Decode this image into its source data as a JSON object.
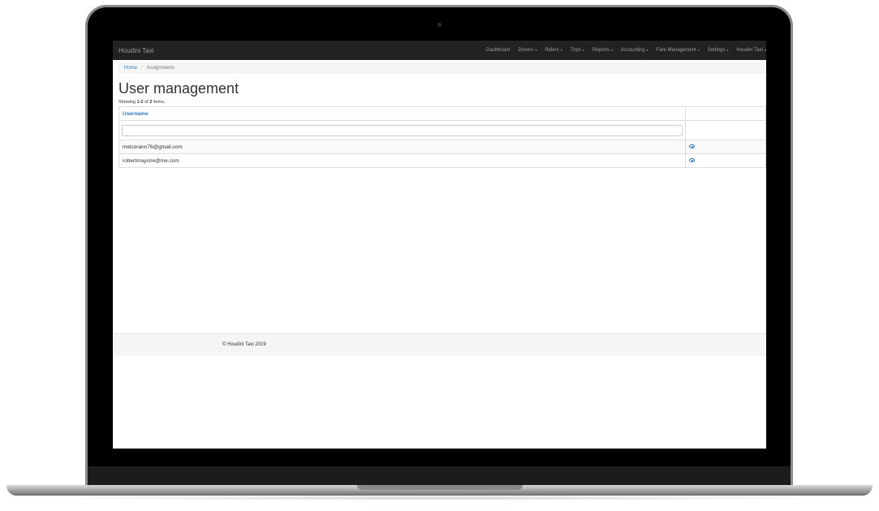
{
  "app": {
    "brand": "Houdini Taxi"
  },
  "nav": {
    "items": [
      {
        "label": "Dashboard",
        "dropdown": false
      },
      {
        "label": "Drivers",
        "dropdown": true
      },
      {
        "label": "Riders",
        "dropdown": true
      },
      {
        "label": "Trips",
        "dropdown": true
      },
      {
        "label": "Reports",
        "dropdown": true
      },
      {
        "label": "Accounting",
        "dropdown": true
      },
      {
        "label": "Fare Management",
        "dropdown": true
      },
      {
        "label": "Settings",
        "dropdown": true
      },
      {
        "label": "Houdini Taxi",
        "dropdown": true
      }
    ],
    "caret": "▾"
  },
  "breadcrumb": {
    "home": "Home",
    "separator": "/",
    "current": "Assignments"
  },
  "page": {
    "title": "User management",
    "summary_prefix": "Showing ",
    "summary_range": "1-2",
    "summary_mid": " of ",
    "summary_total": "2",
    "summary_suffix": " items."
  },
  "table": {
    "columns": [
      "Username"
    ],
    "filter_value": "",
    "rows": [
      {
        "username": "melcorann76@gmail.com",
        "action_icon": "eye-icon"
      },
      {
        "username": "robertmaystre@me.com",
        "action_icon": "eye-icon"
      }
    ]
  },
  "footer": {
    "copyright": "© Houdini Taxi 2019"
  },
  "colors": {
    "navbar": "#222222",
    "link": "#337ab7",
    "nav_text": "#9d9d9d"
  }
}
